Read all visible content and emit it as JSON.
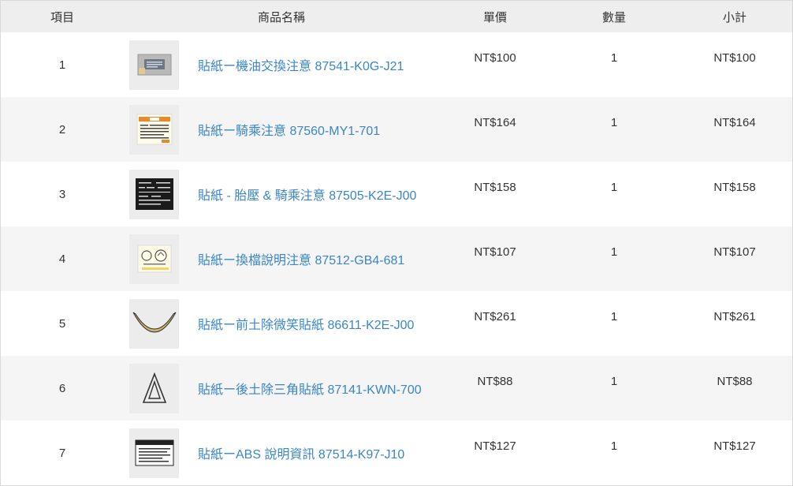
{
  "table": {
    "headers": {
      "index": "項目",
      "name": "商品名稱",
      "price": "單價",
      "qty": "數量",
      "subtotal": "小計"
    },
    "rows": [
      {
        "index": "1",
        "name": "貼紙ー機油交換注意 87541-K0G-J21",
        "price": "NT$100",
        "qty": "1",
        "subtotal": "NT$100",
        "thumb_icon": "oil-change-sticker-icon"
      },
      {
        "index": "2",
        "name": "貼紙ー騎乘注意 87560-MY1-701",
        "price": "NT$164",
        "qty": "1",
        "subtotal": "NT$164",
        "thumb_icon": "riding-caution-sticker-icon"
      },
      {
        "index": "3",
        "name": "貼紙 - 胎壓 & 騎乘注意 87505-K2E-J00",
        "price": "NT$158",
        "qty": "1",
        "subtotal": "NT$158",
        "thumb_icon": "tire-pressure-sticker-icon"
      },
      {
        "index": "4",
        "name": "貼紙ー換檔說明注意 87512-GB4-681",
        "price": "NT$107",
        "qty": "1",
        "subtotal": "NT$107",
        "thumb_icon": "gear-shift-sticker-icon"
      },
      {
        "index": "5",
        "name": "貼紙ー前土除微笑貼紙 86611-K2E-J00",
        "price": "NT$261",
        "qty": "1",
        "subtotal": "NT$261",
        "thumb_icon": "smile-stripe-sticker-icon"
      },
      {
        "index": "6",
        "name": "貼紙ー後土除三角貼紙 87141-KWN-700",
        "price": "NT$88",
        "qty": "1",
        "subtotal": "NT$88",
        "thumb_icon": "triangle-sticker-icon"
      },
      {
        "index": "7",
        "name": "貼紙ーABS 說明資訊 87514-K97-J10",
        "price": "NT$127",
        "qty": "1",
        "subtotal": "NT$127",
        "thumb_icon": "abs-info-sticker-icon"
      }
    ]
  },
  "colors": {
    "link": "#3a86c8",
    "header_bg": "#eeeeee",
    "alt_row_bg": "#f5f5f5"
  }
}
